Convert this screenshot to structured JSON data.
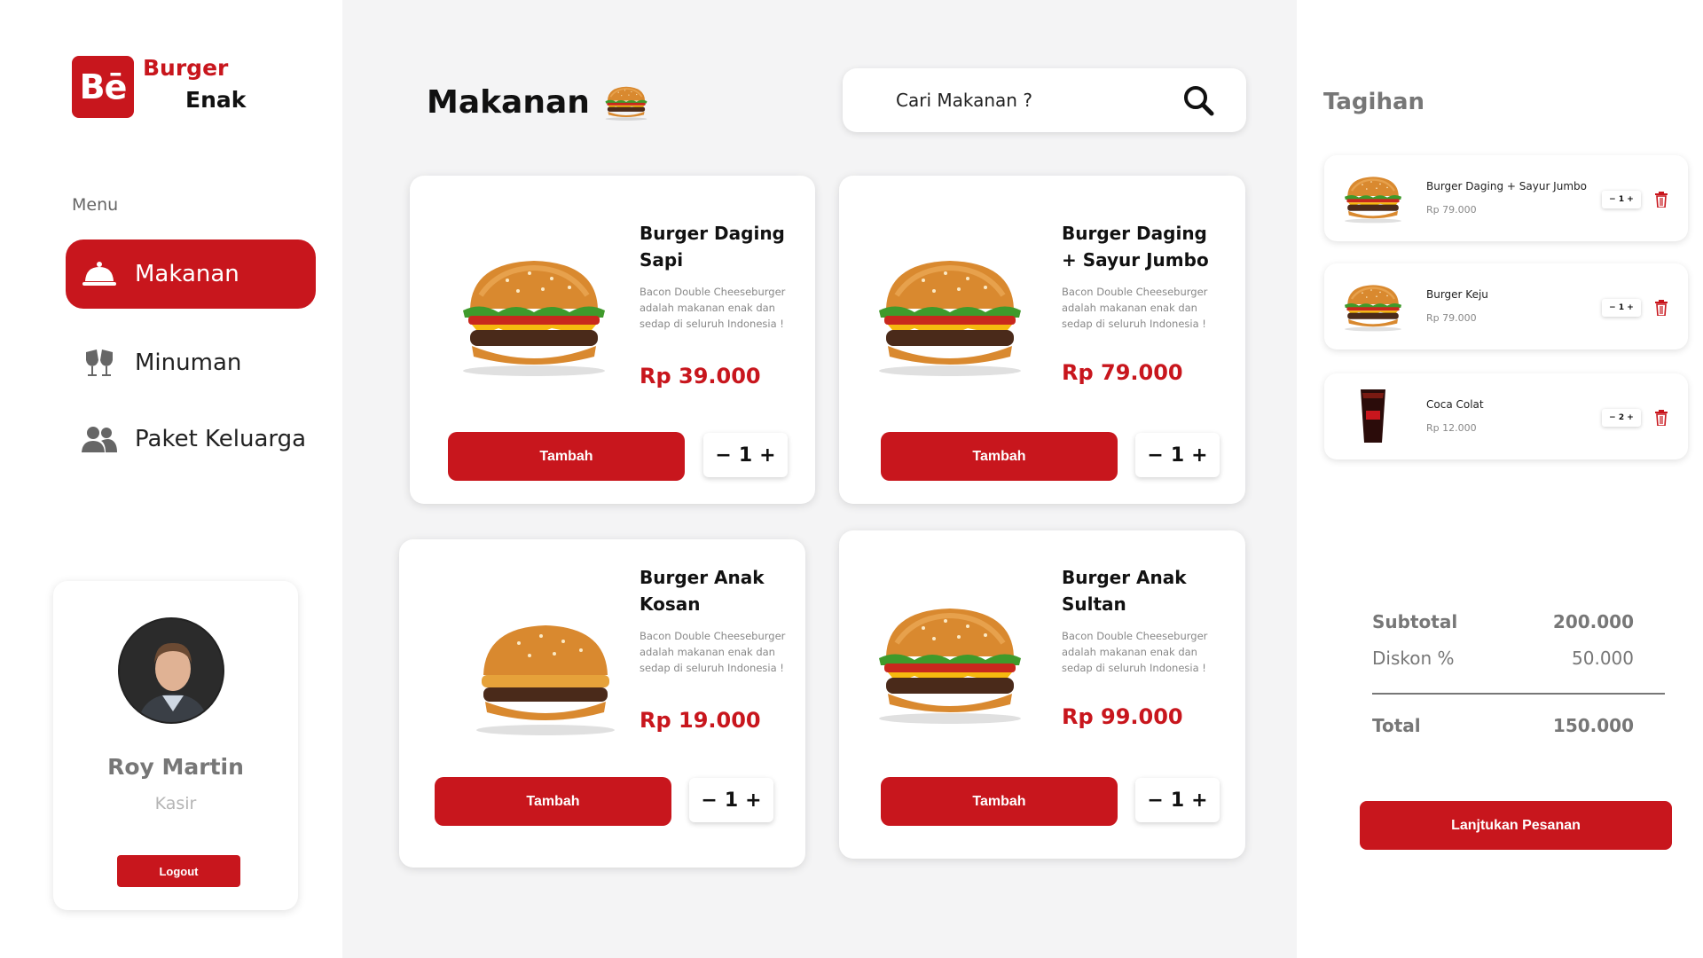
{
  "brand": {
    "logo_mark": "Bē",
    "name_line1": "Burger",
    "name_line2": "Enak",
    "color": "#c8161d"
  },
  "sidebar": {
    "menu_heading": "Menu",
    "items": [
      {
        "label": "Makanan",
        "icon": "cloche-icon",
        "active": true
      },
      {
        "label": "Minuman",
        "icon": "cheers-glasses-icon",
        "active": false
      },
      {
        "label": "Paket Keluarga",
        "icon": "users-icon",
        "active": false
      }
    ]
  },
  "profile": {
    "name": "Roy Martin",
    "role": "Kasir",
    "logout_label": "Logout"
  },
  "main": {
    "title": "Makanan",
    "search": {
      "placeholder": "Cari Makanan ?"
    },
    "products": [
      {
        "name": "Burger Daging Sapi",
        "description": "Bacon Double Cheeseburger adalah makanan enak dan sedap di seluruh Indonesia !",
        "price": "Rp 39.000",
        "add_label": "Tambah",
        "qty": "1"
      },
      {
        "name": "Burger Daging + Sayur Jumbo",
        "description": "Bacon Double Cheeseburger adalah makanan enak dan sedap di seluruh Indonesia !",
        "price": "Rp 79.000",
        "add_label": "Tambah",
        "qty": "1"
      },
      {
        "name": "Burger Anak Kosan",
        "description": "Bacon Double Cheeseburger adalah makanan enak dan sedap di seluruh Indonesia !",
        "price": "Rp 19.000",
        "add_label": "Tambah",
        "qty": "1"
      },
      {
        "name": "Burger Anak Sultan",
        "description": "Bacon Double Cheeseburger adalah makanan enak dan sedap di seluruh Indonesia !",
        "price": "Rp 99.000",
        "add_label": "Tambah",
        "qty": "1"
      }
    ]
  },
  "bill": {
    "title": "Tagihan",
    "items": [
      {
        "name": "Burger Daging + Sayur Jumbo",
        "price": "Rp 79.000",
        "qty": "1"
      },
      {
        "name": "Burger Keju",
        "price": "Rp 79.000",
        "qty": "1"
      },
      {
        "name": "Coca Colat",
        "price": "Rp 12.000",
        "qty": "2"
      }
    ],
    "summary": {
      "subtotal_label": "Subtotal",
      "subtotal_value": "200.000",
      "discount_label": "Diskon %",
      "discount_value": "50.000",
      "total_label": "Total",
      "total_value": "150.000"
    },
    "continue_label": "Lanjtukan Pesanan"
  }
}
